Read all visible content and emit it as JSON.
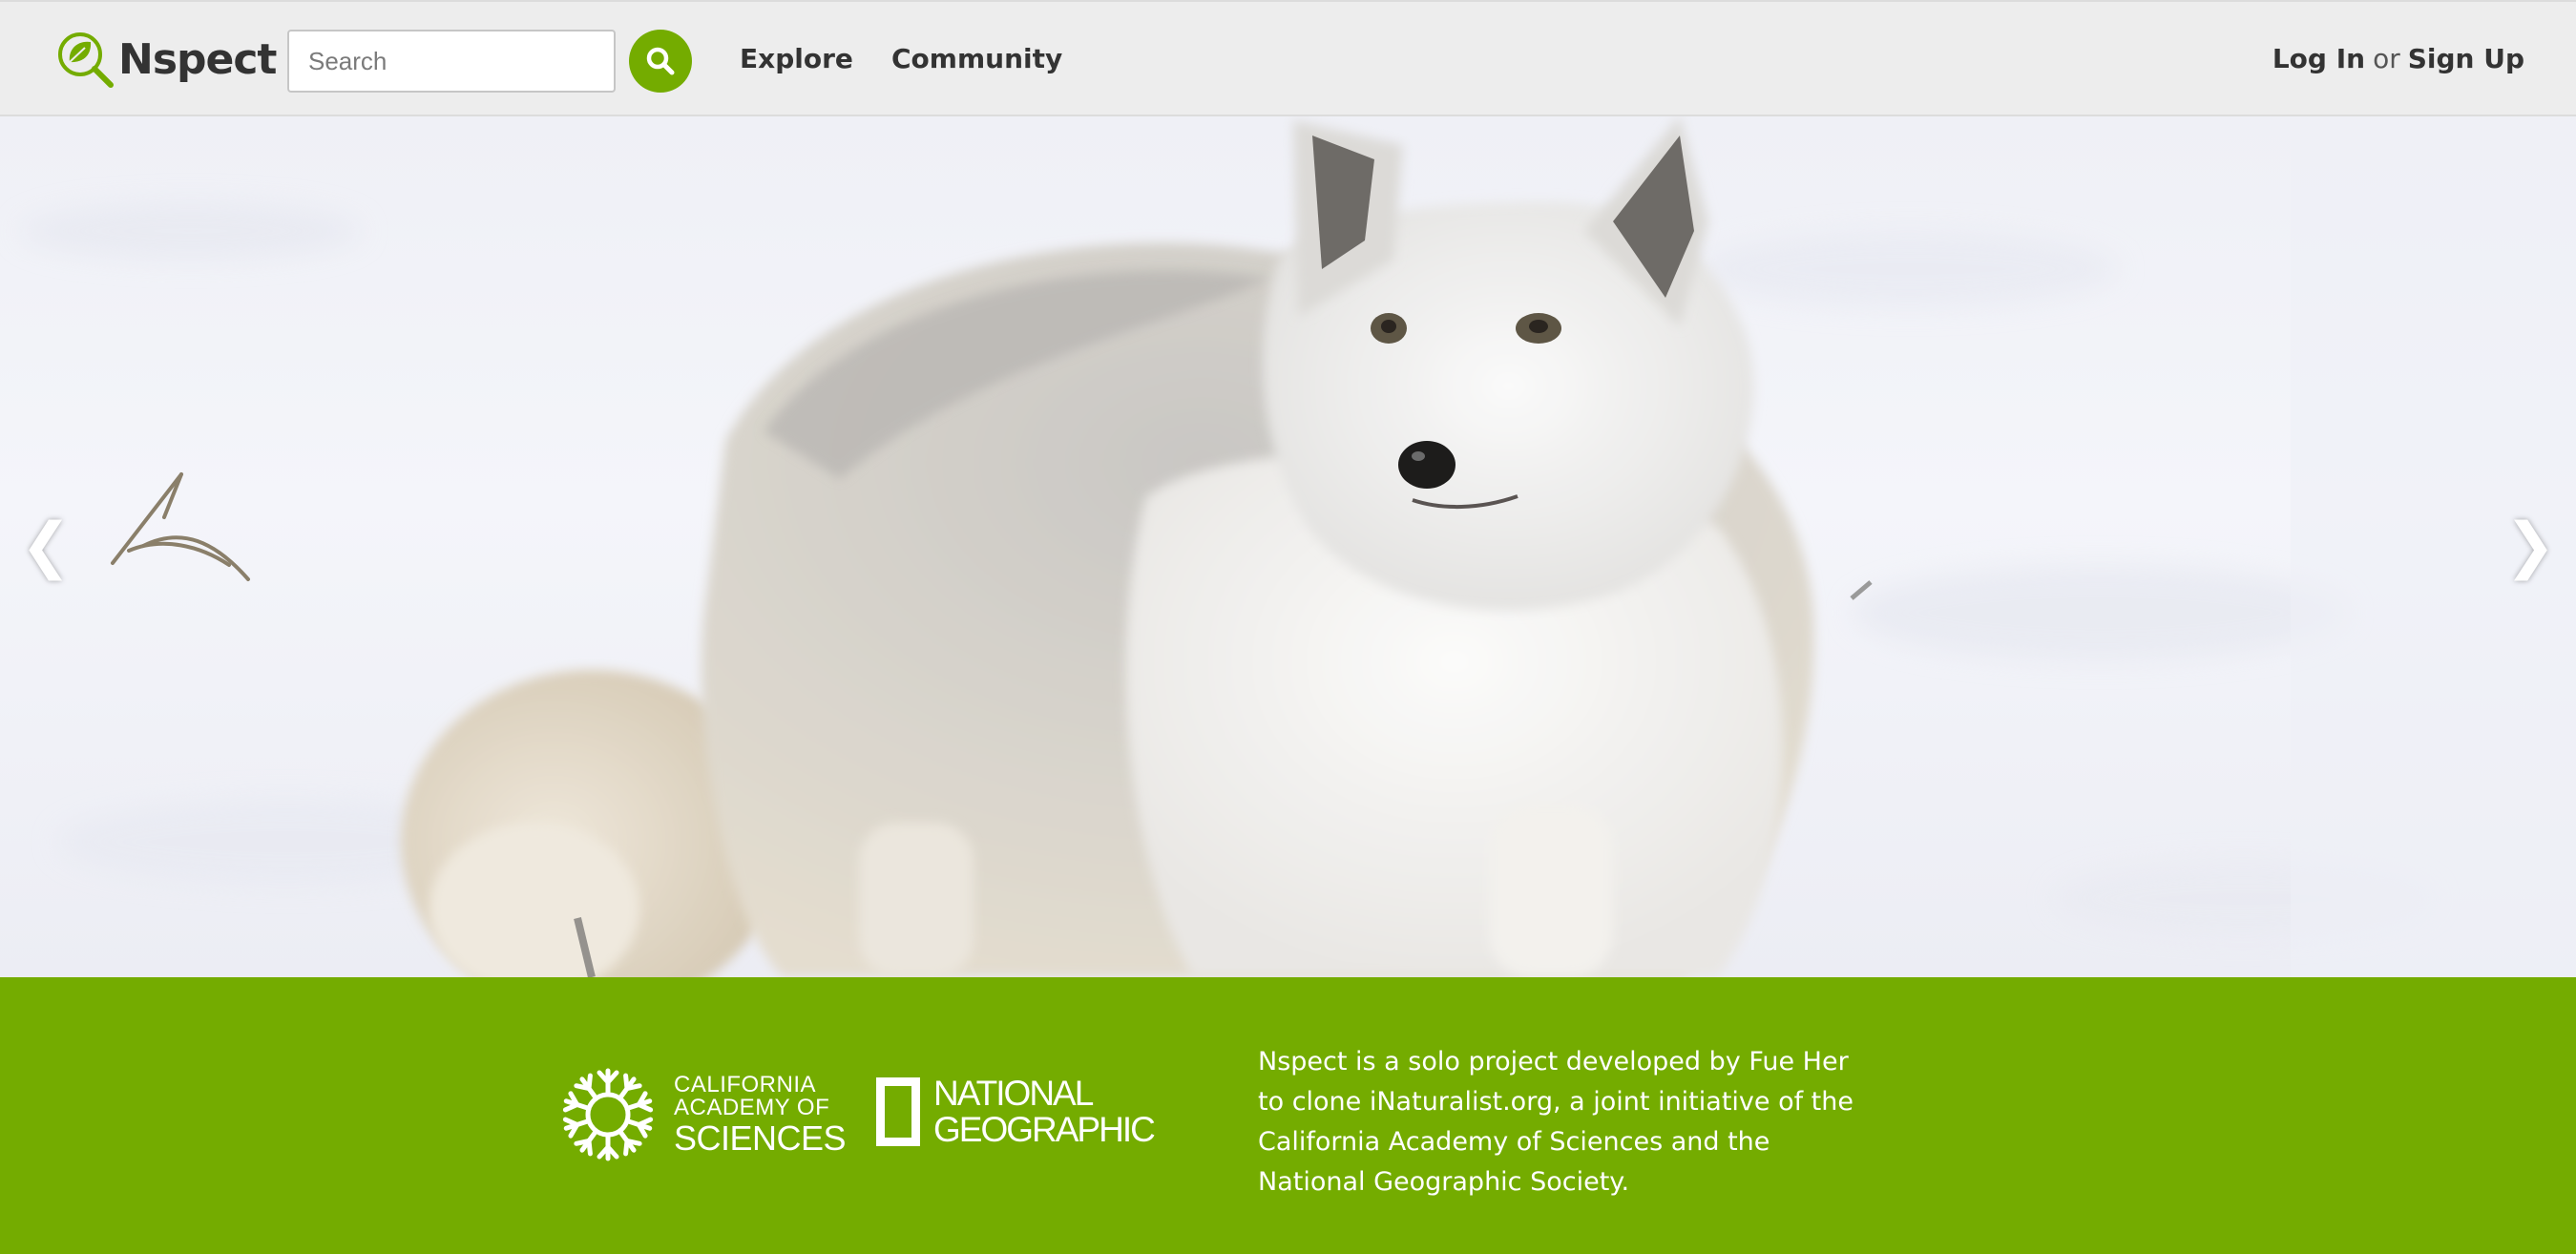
{
  "header": {
    "brand": {
      "name": "Nspect",
      "icon": "magnifier-leaf-icon"
    },
    "search": {
      "placeholder": "Search",
      "value": "",
      "button_icon": "search-icon"
    },
    "nav": [
      {
        "label": "Explore"
      },
      {
        "label": "Community"
      }
    ],
    "auth": {
      "login_label": "Log In",
      "separator": "or",
      "signup_label": "Sign Up"
    }
  },
  "hero": {
    "image": "arctic-fox-in-snow",
    "prev_label": "❮",
    "next_label": "❯"
  },
  "footer": {
    "partners": {
      "cas": {
        "line1": "CALIFORNIA",
        "line2": "ACADEMY OF",
        "line3": "SCIENCES",
        "icon": "cas-snowflake-logo-icon"
      },
      "natgeo": {
        "line1": "NATIONAL",
        "line2": "GEOGRAPHIC",
        "icon": "natgeo-yellow-border-icon"
      }
    },
    "about": "Nspect is a solo project developed by Fue Her to clone iNaturalist.org, a joint initiative of the California Academy of Sciences and the National Geographic Society."
  },
  "colors": {
    "brand_green": "#74ac00",
    "header_bg": "#ededed",
    "text_dark": "#333333",
    "white": "#ffffff"
  }
}
